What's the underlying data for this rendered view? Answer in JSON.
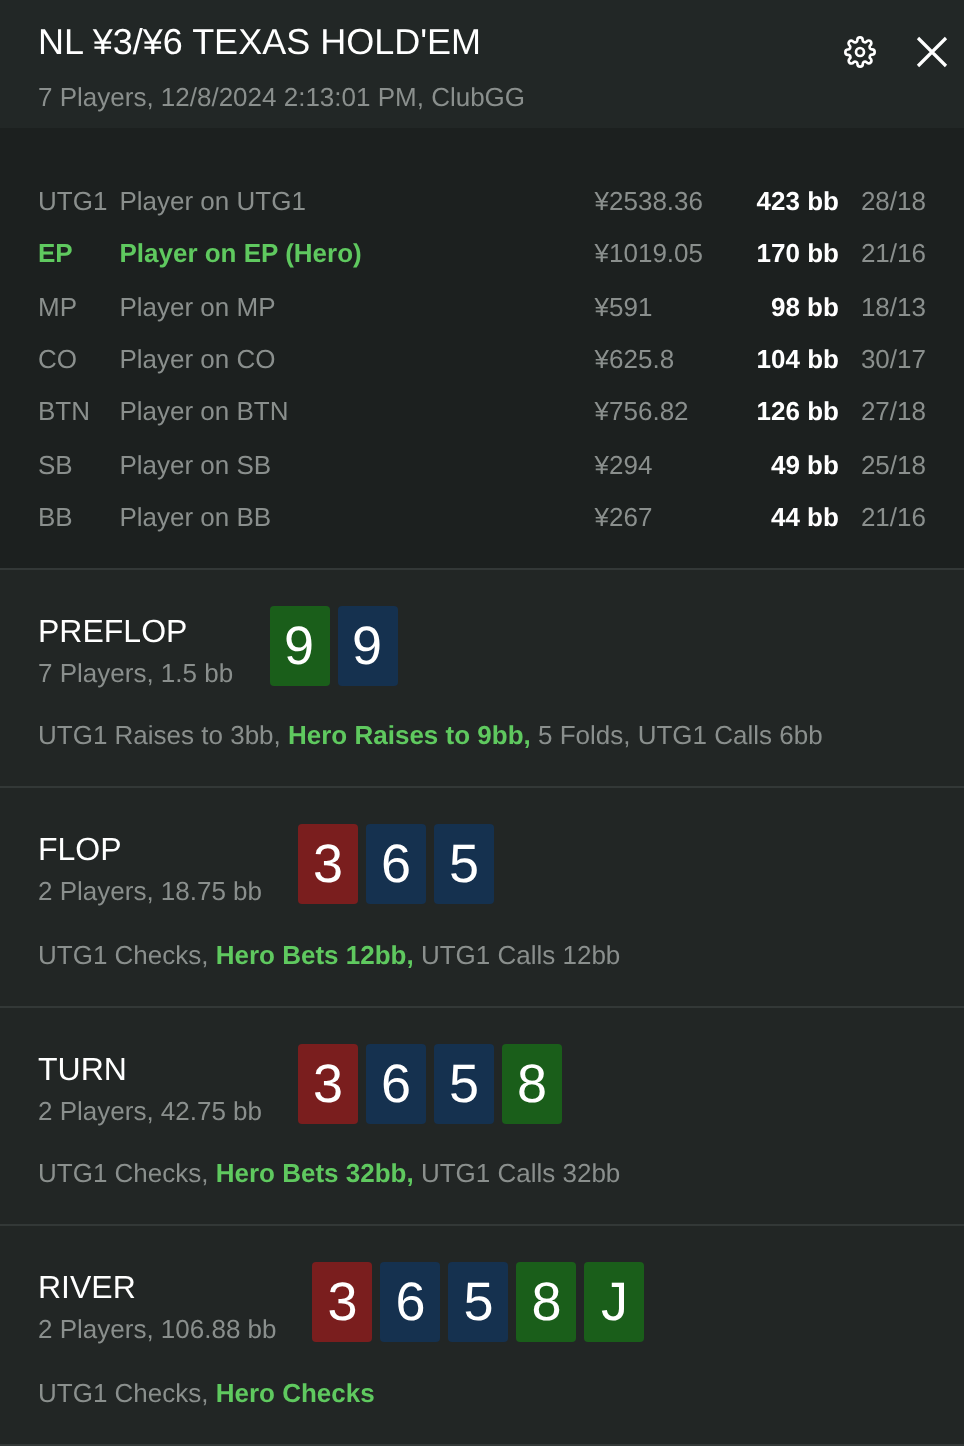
{
  "header": {
    "title": "NL ¥3/¥6 TEXAS HOLD'EM",
    "subtitle": "7 Players, 12/8/2024 2:13:01 PM, ClubGG"
  },
  "players": [
    {
      "position": "UTG1",
      "name": "Player on UTG1",
      "stack": "¥2538.36",
      "bb": "423 bb",
      "stats": "28/18",
      "hero": false
    },
    {
      "position": "EP",
      "name": "Player on EP (Hero)",
      "stack": "¥1019.05",
      "bb": "170 bb",
      "stats": "21/16",
      "hero": true
    },
    {
      "position": "MP",
      "name": "Player on MP",
      "stack": "¥591",
      "bb": "98 bb",
      "stats": "18/13",
      "hero": false
    },
    {
      "position": "CO",
      "name": "Player on CO",
      "stack": "¥625.8",
      "bb": "104 bb",
      "stats": "30/17",
      "hero": false
    },
    {
      "position": "BTN",
      "name": "Player on BTN",
      "stack": "¥756.82",
      "bb": "126 bb",
      "stats": "27/18",
      "hero": false
    },
    {
      "position": "SB",
      "name": "Player on SB",
      "stack": "¥294",
      "bb": "49 bb",
      "stats": "25/18",
      "hero": false
    },
    {
      "position": "BB",
      "name": "Player on BB",
      "stack": "¥267",
      "bb": "44 bb",
      "stats": "21/16",
      "hero": false
    }
  ],
  "streets": [
    {
      "name": "PREFLOP",
      "info": "7 Players, 1.5 bb",
      "cards": [
        {
          "rank": "9",
          "color": "#1a5e1a"
        },
        {
          "rank": "9",
          "color": "#15314f"
        }
      ],
      "actions": "UTG1 Raises to 3bb, **Hero Raises to 9bb,** 5 Folds, UTG1 Calls 6bb"
    },
    {
      "name": "FLOP",
      "info": "2 Players, 18.75 bb",
      "cards": [
        {
          "rank": "3",
          "color": "#7a1e1e"
        },
        {
          "rank": "6",
          "color": "#15314f"
        },
        {
          "rank": "5",
          "color": "#15314f"
        }
      ],
      "actions": "UTG1 Checks, **Hero Bets 12bb,** UTG1 Calls 12bb"
    },
    {
      "name": "TURN",
      "info": "2 Players, 42.75 bb",
      "cards": [
        {
          "rank": "3",
          "color": "#7a1e1e"
        },
        {
          "rank": "6",
          "color": "#15314f"
        },
        {
          "rank": "5",
          "color": "#15314f"
        },
        {
          "rank": "8",
          "color": "#1a5e1a"
        }
      ],
      "actions": "UTG1 Checks, **Hero Bets 32bb,** UTG1 Calls 32bb"
    },
    {
      "name": "RIVER",
      "info": "2 Players, 106.88 bb",
      "cards": [
        {
          "rank": "3",
          "color": "#7a1e1e"
        },
        {
          "rank": "6",
          "color": "#15314f"
        },
        {
          "rank": "5",
          "color": "#15314f"
        },
        {
          "rank": "8",
          "color": "#1a5e1a"
        },
        {
          "rank": "J",
          "color": "#1a5e1a"
        }
      ],
      "actions": "UTG1 Checks, **Hero Checks**"
    }
  ]
}
